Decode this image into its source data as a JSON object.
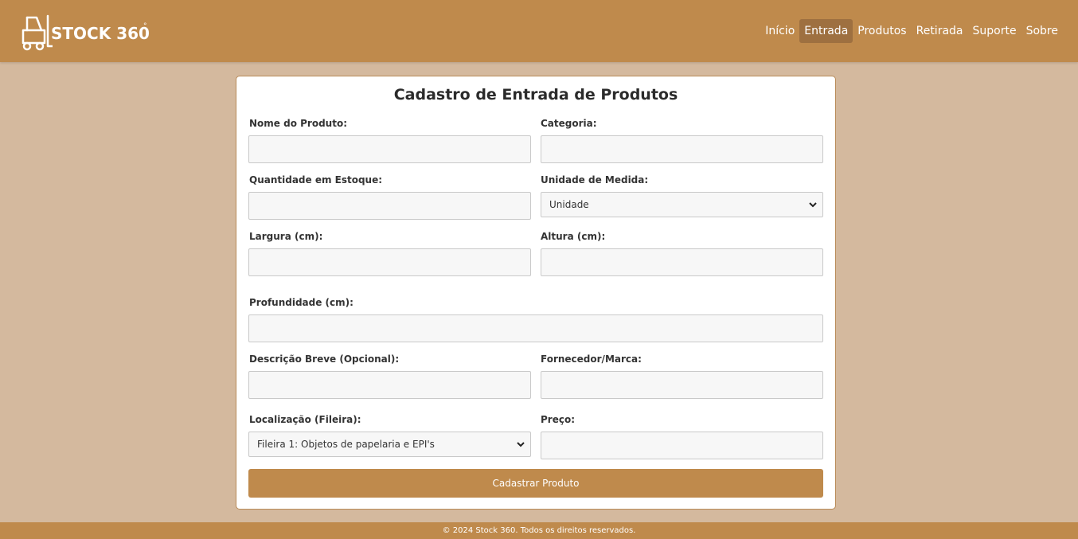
{
  "brand": {
    "name": "STOCK 360",
    "degree": "°"
  },
  "nav": {
    "items": [
      {
        "label": "Início",
        "active": false
      },
      {
        "label": "Entrada",
        "active": true
      },
      {
        "label": "Produtos",
        "active": false
      },
      {
        "label": "Retirada",
        "active": false
      },
      {
        "label": "Suporte",
        "active": false
      },
      {
        "label": "Sobre",
        "active": false
      }
    ]
  },
  "form": {
    "title": "Cadastro de Entrada de Produtos",
    "nome_label": "Nome do Produto:",
    "categoria_label": "Categoria:",
    "quantidade_label": "Quantidade em Estoque:",
    "unidade_label": "Unidade de Medida:",
    "unidade_value": "Unidade",
    "largura_label": "Largura (cm):",
    "altura_label": "Altura (cm):",
    "profundidade_label": "Profundidade (cm):",
    "descricao_label": "Descrição Breve (Opcional):",
    "fornecedor_label": "Fornecedor/Marca:",
    "localizacao_label": "Localização (Fileira):",
    "localizacao_value": "Fileira 1: Objetos de papelaria e EPI's",
    "preco_label": "Preço:",
    "submit_label": "Cadastrar Produto"
  },
  "footer": {
    "text": "© 2024 Stock 360. Todos os direitos reservados."
  },
  "colors": {
    "header": "#bf8a4c",
    "background": "#d4b99e",
    "active_nav": "#9e7040",
    "button": "#bf8a4c"
  },
  "icons": {
    "logo": "forklift-icon",
    "select": "chevron-down-icon"
  }
}
